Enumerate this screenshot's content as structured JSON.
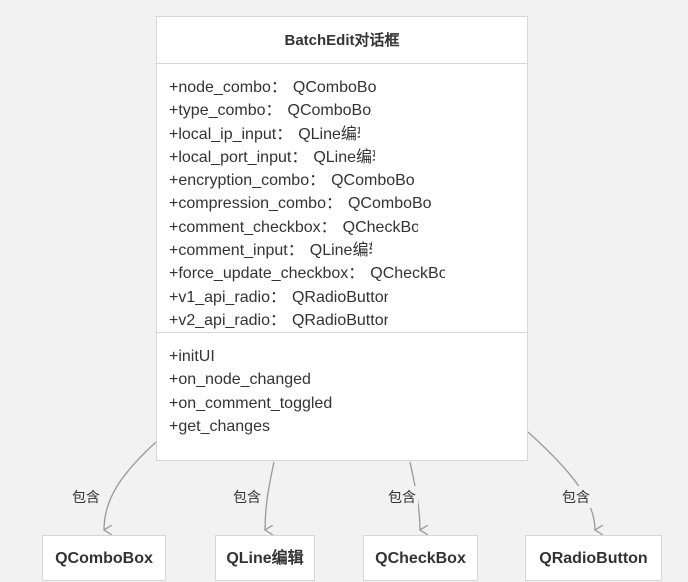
{
  "class": {
    "title": "BatchEdit对话框",
    "attributes": [
      {
        "name": "+node_combo：",
        "type": "QComboBox"
      },
      {
        "name": "+type_combo：",
        "type": "QComboBox"
      },
      {
        "name": "+local_ip_input：",
        "type": "QLine编辑"
      },
      {
        "name": "+local_port_input：",
        "type": "QLine编辑"
      },
      {
        "name": "+encryption_combo：",
        "type": "QComboBox"
      },
      {
        "name": "+compression_combo：",
        "type": "QComboBox"
      },
      {
        "name": "+comment_checkbox：",
        "type": "QCheckBox"
      },
      {
        "name": "+comment_input：",
        "type": "QLine编辑"
      },
      {
        "name": "+force_update_checkbox：",
        "type": "QCheckBox"
      },
      {
        "name": "+v1_api_radio：",
        "type": "QRadioButton"
      },
      {
        "name": "+v2_api_radio：",
        "type": "QRadioButton"
      }
    ],
    "methods": [
      "+initUI",
      "+on_node_changed",
      "+on_comment_toggled",
      "+get_changes"
    ]
  },
  "relations": [
    {
      "label": "包含",
      "target": "QComboBox"
    },
    {
      "label": "包含",
      "target": "QLine编辑"
    },
    {
      "label": "包含",
      "target": "QCheckBox"
    },
    {
      "label": "包含",
      "target": "QRadioButton"
    }
  ]
}
